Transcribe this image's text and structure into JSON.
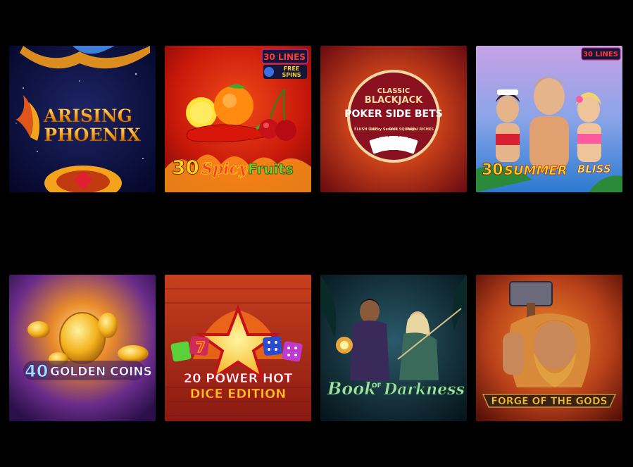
{
  "games": [
    {
      "id": "arising-phoenix",
      "title_line1": "ARISING",
      "title_line2": "PHOENIX",
      "colors": {
        "bg": "#0b0f3a",
        "accent": "#f3a21c"
      }
    },
    {
      "id": "30-spicy-fruits",
      "title_number": "30",
      "title_word1": "Spicy",
      "title_word2": "Fruits",
      "badge_lines": "30 LINES",
      "badge_free": "FREE",
      "badge_spins": "SPINS",
      "colors": {
        "bg": "#d4210b",
        "accent": "#ffd21e"
      }
    },
    {
      "id": "classic-blackjack-poker-side-bets",
      "line1": "CLASSIC",
      "line2": "BLACKJACK",
      "line3": "POKER SIDE BETS",
      "side_bets": [
        "FLUSH OUT",
        "Lucky Sevens",
        "PAIR SQUARE",
        "Royal RICHES"
      ],
      "colors": {
        "bg": "#b4231a",
        "accent": "#f4d9a0"
      }
    },
    {
      "id": "30-summer-bliss",
      "title_number": "30",
      "title_word1": "SUMMER",
      "title_word2": "BLISS",
      "badge_lines": "30 LINES",
      "colors": {
        "bg": "#7f8fd8",
        "accent": "#ffd21e"
      }
    },
    {
      "id": "40-golden-coins",
      "title_number": "40",
      "title_word": "GOLDEN COINS",
      "colors": {
        "bg": "#6a2c8a",
        "accent": "#ffc83a"
      }
    },
    {
      "id": "20-power-hot-dice-edition",
      "title_line1": "20 POWER HOT",
      "title_line2": "DICE EDITION",
      "colors": {
        "bg": "#a8281e",
        "accent": "#ffd21e"
      }
    },
    {
      "id": "book-of-darkness",
      "title_word1": "Book",
      "title_of": "OF",
      "title_word2": "Darkness",
      "colors": {
        "bg": "#0f2a34",
        "accent": "#9fe0a6"
      }
    },
    {
      "id": "forge-of-the-gods",
      "title": "FORGE OF THE GODS",
      "colors": {
        "bg": "#b8401a",
        "accent": "#f0c040"
      }
    }
  ]
}
